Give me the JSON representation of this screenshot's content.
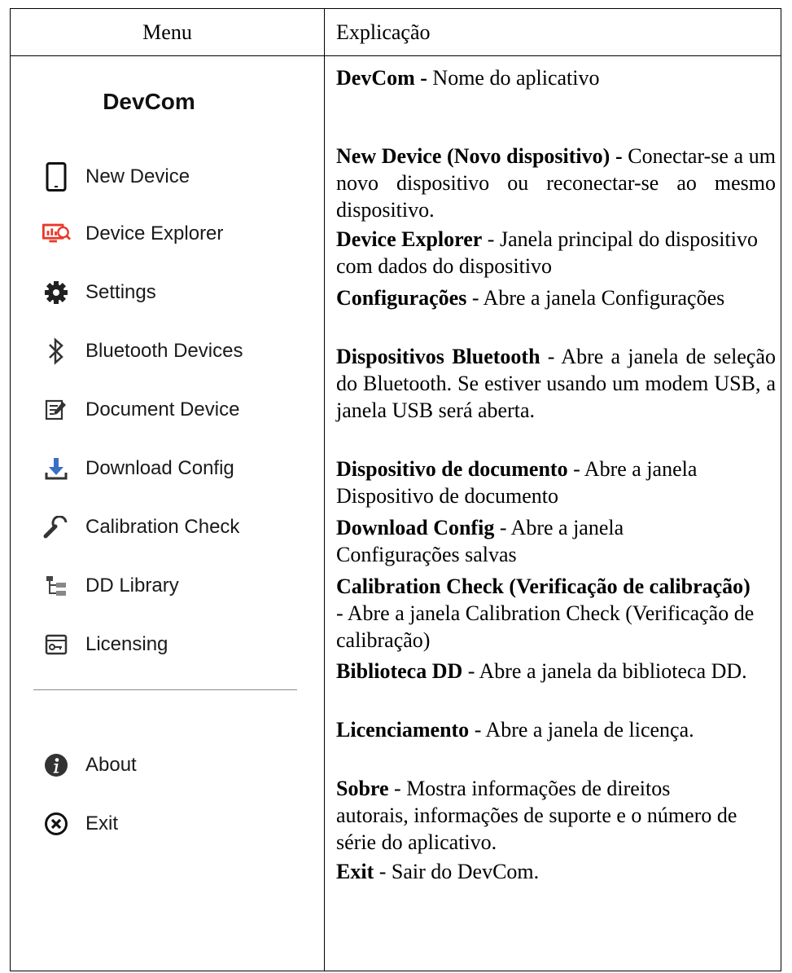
{
  "header": {
    "menu": "Menu",
    "explanation": "Explicação"
  },
  "menu": {
    "app_title": "DevCom",
    "items": [
      {
        "label": "New Device",
        "icon": "tablet-icon"
      },
      {
        "label": "Device Explorer",
        "icon": "device-explorer-icon"
      },
      {
        "label": "Settings",
        "icon": "gear-icon"
      },
      {
        "label": "Bluetooth Devices",
        "icon": "bluetooth-icon"
      },
      {
        "label": "Document Device",
        "icon": "document-edit-icon"
      },
      {
        "label": "Download Config",
        "icon": "download-icon"
      },
      {
        "label": "Calibration Check",
        "icon": "wrench-icon"
      },
      {
        "label": "DD Library",
        "icon": "library-tree-icon"
      },
      {
        "label": "Licensing",
        "icon": "license-key-icon"
      }
    ],
    "bottom_items": [
      {
        "label": "About",
        "icon": "info-icon"
      },
      {
        "label": "Exit",
        "icon": "exit-icon"
      }
    ]
  },
  "explanations": [
    {
      "term": "DevCom -",
      "text": " Nome do aplicativo"
    },
    {
      "term": "New Device (Novo dispositivo) -",
      "text": " Conectar-se a um novo dispositivo ou reconectar-se ao mesmo dispositivo."
    },
    {
      "term": "Device Explorer",
      "text": " - Janela principal do dispositivo com dados do dispositivo"
    },
    {
      "term": "Configurações",
      "text": " - Abre a janela Configurações"
    },
    {
      "term": "Dispositivos Bluetooth",
      "text": " - Abre a janela de seleção do Bluetooth. Se estiver usando um modem USB, a janela USB será aberta."
    },
    {
      "term": "Dispositivo de documento",
      "text": " - Abre a janela Dispositivo de documento"
    },
    {
      "term": "Download Config",
      "text": " - Abre a janela Configurações salvas"
    },
    {
      "term": "Calibration Check (Verificação de calibração)",
      "text": " - Abre a janela Calibration Check (Verificação de calibração)"
    },
    {
      "term": "Biblioteca DD",
      "text": " - Abre a janela da biblioteca DD."
    },
    {
      "term": "Licenciamento",
      "text": " - Abre a janela de licença."
    },
    {
      "term": "Sobre",
      "text": " - Mostra informações de direitos autorais, informações de suporte e o número de série do aplicativo."
    },
    {
      "term": "Exit",
      "text": " - Sair do DevCom."
    }
  ],
  "colors": {
    "explorer_icon": "#e8392b",
    "icon_dark": "#222222",
    "icon_blue": "#3b6fc4"
  }
}
